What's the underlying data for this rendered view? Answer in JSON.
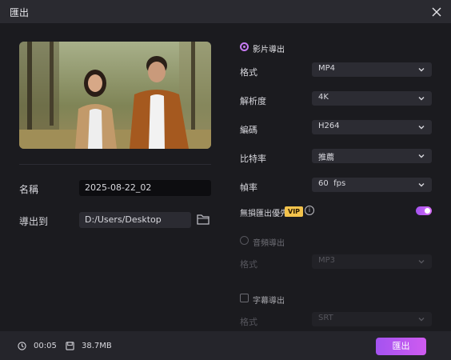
{
  "window": {
    "title": "匯出"
  },
  "preview": {
    "alt": "couple walking in park"
  },
  "left": {
    "name_label": "名稱",
    "name_value": "2025-08-22_02",
    "path_label": "導出到",
    "path_value": "D:/Users/Desktop"
  },
  "video_export": {
    "title": "影片導出",
    "rows": [
      {
        "label": "格式",
        "value": "MP4"
      },
      {
        "label": "解析度",
        "value": "4K"
      },
      {
        "label": "編碼",
        "value": "H264"
      },
      {
        "label": "比特率",
        "value": "推薦"
      },
      {
        "label": "幀率",
        "value": "60  fps"
      }
    ],
    "lossless_label": "無損匯出優先",
    "vip_badge": "VIP",
    "info_icon": "i",
    "lossless_enabled": true
  },
  "audio_export": {
    "title": "音頻導出",
    "format_label": "格式",
    "format_value": "MP3"
  },
  "subtitle_export": {
    "title": "字幕導出",
    "format_label": "格式",
    "format_value": "SRT"
  },
  "footer": {
    "duration": "00:05",
    "size": "38.7MB",
    "export_label": "匯出"
  },
  "colors": {
    "accent": "#c77bf3",
    "vip": "#f3c34c",
    "background": "#1b1b1f"
  }
}
